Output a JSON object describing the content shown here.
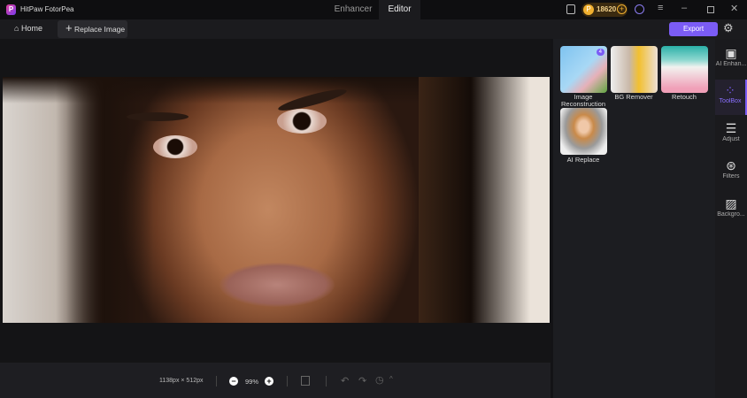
{
  "app": {
    "title": "HitPaw FotorPea",
    "logo": "P"
  },
  "tabs": [
    {
      "label": "Enhancer",
      "active": false
    },
    {
      "label": "Editor",
      "active": true
    }
  ],
  "credits": "18620",
  "toolbar": {
    "home": "Home",
    "replace": "Replace Image",
    "export": "Export"
  },
  "tools": [
    {
      "label": "Image Reconstruction",
      "badge": "4"
    },
    {
      "label": "BG Remover"
    },
    {
      "label": "Retouch"
    },
    {
      "label": "AI Replace"
    }
  ],
  "rail": [
    {
      "label": "AI Enhan..."
    },
    {
      "label": "ToolBox",
      "active": true
    },
    {
      "label": "Adjust"
    },
    {
      "label": "Filters"
    },
    {
      "label": "Backgro..."
    }
  ],
  "status": {
    "dimensions": "1138px × 512px",
    "zoom": "99%"
  },
  "colors": {
    "accent": "#7b5cf5"
  }
}
